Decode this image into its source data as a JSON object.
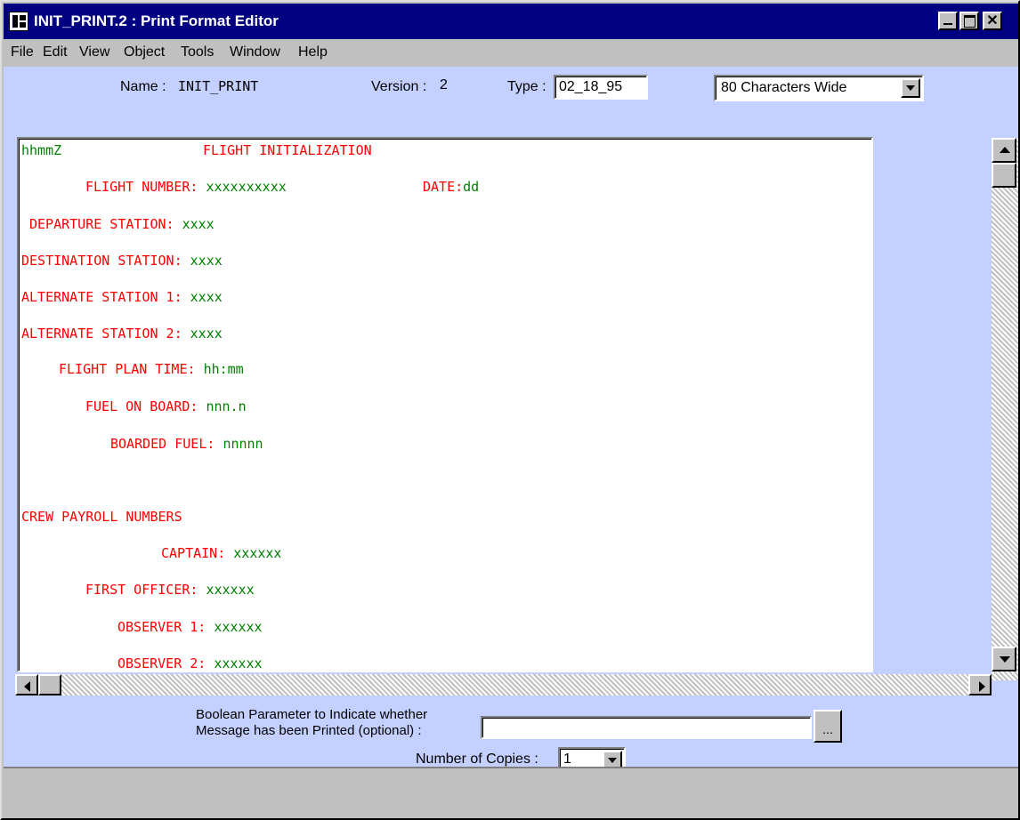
{
  "window": {
    "title": "INIT_PRINT.2 : Print Format Editor",
    "close_glyph": "✕"
  },
  "menu": [
    "File",
    "Edit",
    "View",
    "Object",
    "Tools",
    "Window",
    "Help"
  ],
  "header": {
    "name_label": "Name :",
    "name_value": "INIT_PRINT",
    "version_label": "Version :",
    "version_value": "2",
    "type_label": "Type :",
    "type_value": "02_18_95",
    "width_value": "80 Characters Wide"
  },
  "editor": {
    "lines": [
      {
        "red": "",
        "green": "hhmmZ",
        "extra": "FLIGHT INITIALIZATION"
      },
      {
        "red": "FLIGHT NUMBER:",
        "green": "xxxxxxxxxx",
        "extra": "DATE:",
        "extra_value": "dd"
      },
      {
        "red": "DEPARTURE STATION:",
        "green": "xxxx"
      },
      {
        "red": "DESTINATION STATION:",
        "green": "xxxx"
      },
      {
        "red": "ALTERNATE STATION 1:",
        "green": "xxxx"
      },
      {
        "red": "ALTERNATE STATION 2:",
        "green": "xxxx"
      },
      {
        "red": "FLIGHT PLAN TIME:",
        "green": "hh:mm"
      },
      {
        "red": "FUEL ON BOARD:",
        "green": "nnn.n"
      },
      {
        "red": "BOARDED FUEL:",
        "green": "nnnnn"
      },
      {
        "red": "CREW PAYROLL NUMBERS",
        "green": ""
      },
      {
        "red": "CAPTAIN:",
        "green": "xxxxxx"
      },
      {
        "red": "FIRST OFFICER:",
        "green": "xxxxxx"
      },
      {
        "red": "OBSERVER 1:",
        "green": "xxxxxx"
      },
      {
        "red": "OBSERVER 2:",
        "green": "xxxxxx"
      }
    ]
  },
  "footer": {
    "boolean_label_line1": "Boolean Parameter to Indicate whether",
    "boolean_label_line2": "Message has been Printed (optional) :",
    "boolean_value": "",
    "ellipsis": "...",
    "copies_label": "Number of Copies :",
    "copies_value": "1"
  },
  "colors": {
    "title_bar": "#000080",
    "form_bg": "#c4d0ff",
    "label_red": "#ff0000",
    "value_green": "#008000"
  }
}
